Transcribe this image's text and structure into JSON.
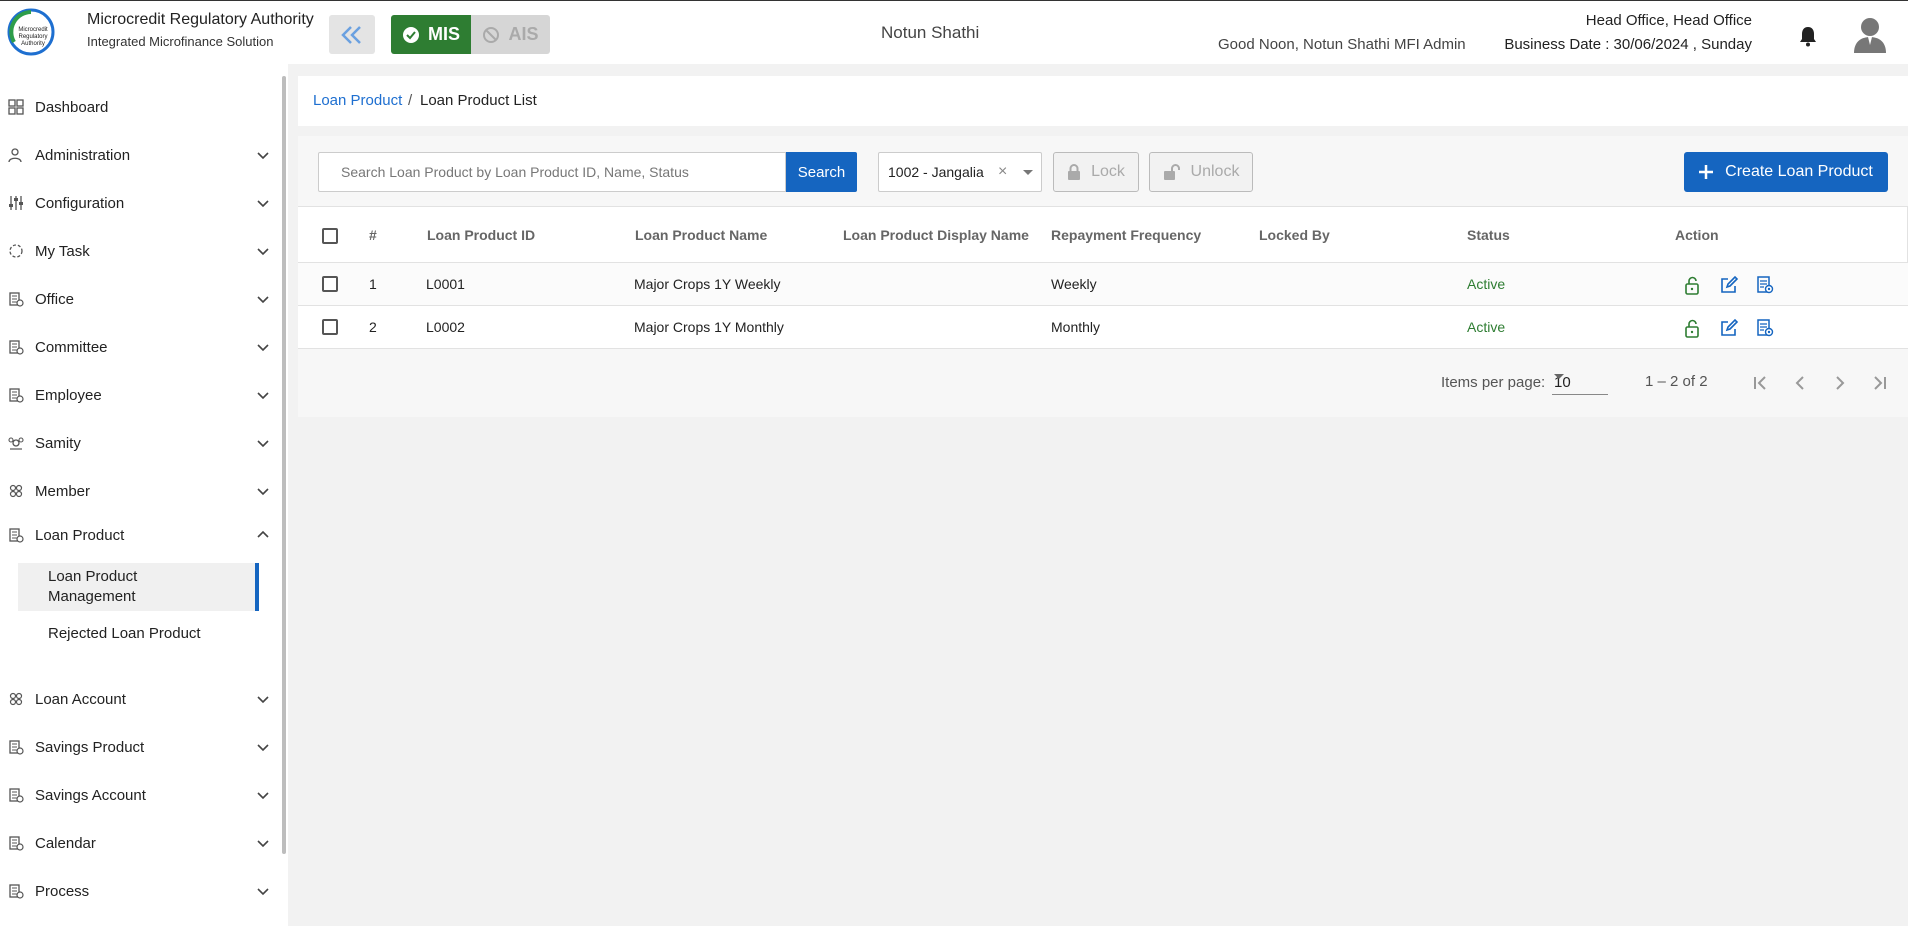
{
  "header": {
    "org_title": "Microcredit Regulatory Authority",
    "org_subtitle": "Integrated Microfinance Solution",
    "logo_text": "Microcredit Regulatory Authority",
    "mis_label": "MIS",
    "ais_label": "AIS",
    "center_name": "Notun Shathi",
    "greeting": "Good Noon, Notun Shathi MFI Admin",
    "office": "Head Office, Head Office",
    "business_date": "Business Date : 30/06/2024 , Sunday"
  },
  "sidebar": {
    "items": [
      {
        "label": "Dashboard",
        "icon": "dashboard-icon"
      },
      {
        "label": "Administration",
        "icon": "administration-icon"
      },
      {
        "label": "Configuration",
        "icon": "configuration-icon"
      },
      {
        "label": "My Task",
        "icon": "task-icon"
      },
      {
        "label": "Office",
        "icon": "office-icon"
      },
      {
        "label": "Committee",
        "icon": "committee-icon"
      },
      {
        "label": "Employee",
        "icon": "employee-icon"
      },
      {
        "label": "Samity",
        "icon": "samity-icon"
      },
      {
        "label": "Member",
        "icon": "member-icon"
      },
      {
        "label": "Loan Product",
        "icon": "loan-product-icon",
        "expanded": true
      },
      {
        "label": "Loan Account",
        "icon": "loan-account-icon"
      },
      {
        "label": "Savings Product",
        "icon": "savings-product-icon"
      },
      {
        "label": "Savings Account",
        "icon": "savings-account-icon"
      },
      {
        "label": "Calendar",
        "icon": "calendar-icon"
      },
      {
        "label": "Process",
        "icon": "process-icon"
      }
    ],
    "sub_items": [
      {
        "label": "Loan Product Management",
        "active": true
      },
      {
        "label": "Rejected Loan Product",
        "active": false
      }
    ]
  },
  "breadcrumb": {
    "parent": "Loan Product",
    "separator": "/",
    "current": "Loan Product List"
  },
  "toolbar": {
    "search_placeholder": "Search Loan Product by Loan Product ID, Name, Status",
    "search_value": "",
    "search_label": "Search",
    "branch_value": "1002 - Jangalia",
    "clear_symbol": "×",
    "lock_label": "Lock",
    "unlock_label": "Unlock",
    "create_label": "Create Loan Product"
  },
  "table": {
    "columns": [
      "#",
      "Loan Product ID",
      "Loan Product Name",
      "Loan Product Display Name",
      "Repayment Frequency",
      "Locked By",
      "Status",
      "Action"
    ],
    "rows": [
      {
        "num": "1",
        "id": "L0001",
        "name": "Major Crops 1Y Weekly",
        "display_name": "",
        "frequency": "Weekly",
        "locked_by": "",
        "status": "Active"
      },
      {
        "num": "2",
        "id": "L0002",
        "name": "Major Crops 1Y Monthly",
        "display_name": "",
        "frequency": "Monthly",
        "locked_by": "",
        "status": "Active"
      }
    ]
  },
  "paginator": {
    "items_per_page_label": "Items per page:",
    "page_size": "10",
    "range": "1 – 2 of 2"
  },
  "colors": {
    "primary": "#1565c0",
    "success": "#2e7d32",
    "link": "#1e6fd0"
  }
}
